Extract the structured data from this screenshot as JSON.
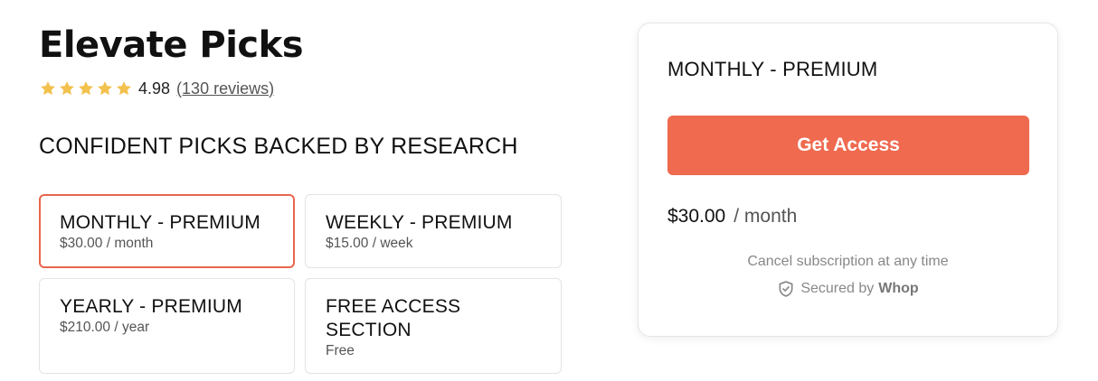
{
  "store": {
    "title": "Elevate Picks",
    "rating": "4.98",
    "rating_stars": 5,
    "reviews_label": "(130 reviews)",
    "tagline": "CONFIDENT PICKS BACKED BY RESEARCH"
  },
  "plans": [
    {
      "name": "MONTHLY - PREMIUM",
      "price": "$30.00 / month",
      "selected": true
    },
    {
      "name": "WEEKLY - PREMIUM",
      "price": "$15.00 / week",
      "selected": false
    },
    {
      "name": "YEARLY - PREMIUM",
      "price": "$210.00 / year",
      "selected": false
    },
    {
      "name": "FREE ACCESS SECTION",
      "price": "Free",
      "selected": false
    }
  ],
  "checkout": {
    "plan_name": "MONTHLY - PREMIUM",
    "button_label": "Get Access",
    "price_amount": "$30.00",
    "price_period": "/ month",
    "cancel_note": "Cancel subscription at any time",
    "secured_label": "Secured by",
    "secured_brand": "Whop"
  },
  "colors": {
    "accent": "#ef6a4f",
    "selected_border": "#e8664c",
    "star": "#f2c14e"
  },
  "icons": {
    "star": "star-icon",
    "shield": "shield-check-icon"
  }
}
